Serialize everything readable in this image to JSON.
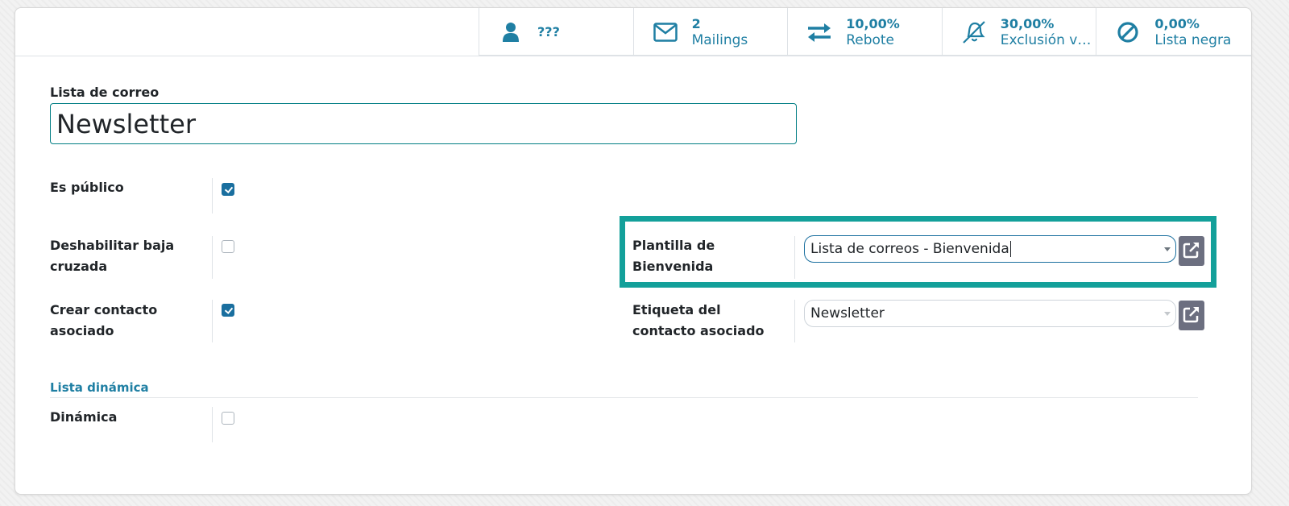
{
  "stats": [
    {
      "value": "???",
      "label": "",
      "icon": "user-icon"
    },
    {
      "value": "2",
      "label": "Mailings",
      "icon": "envelope-icon"
    },
    {
      "value": "10,00%",
      "label": "Rebote",
      "icon": "exchange-icon"
    },
    {
      "value": "30,00%",
      "label": "Exclusión vo...",
      "icon": "bell-slash-icon"
    },
    {
      "value": "0,00%",
      "label": "Lista negra",
      "icon": "ban-icon"
    }
  ],
  "form": {
    "name_label": "Lista de correo",
    "name_value": "Newsletter",
    "is_public_label": "Es público",
    "is_public": true,
    "disable_cross_unsub_label_1": "Deshabilitar baja",
    "disable_cross_unsub_label_2": "cruzada",
    "disable_cross_unsub": false,
    "create_contact_label_1": "Crear contacto",
    "create_contact_label_2": "asociado",
    "create_contact": true,
    "welcome_template_label_1": "Plantilla de",
    "welcome_template_label_2": "Bienvenida",
    "welcome_template_value": "Lista de correos - Bienvenida",
    "contact_tag_label_1": "Etiqueta del",
    "contact_tag_label_2": "contacto asociado",
    "contact_tag_value": "Newsletter",
    "dynamic_section_title": "Lista dinámica",
    "dynamic_label": "Dinámica",
    "dynamic": false
  },
  "colors": {
    "accent": "#1f7fa3",
    "highlight": "#13a09a",
    "checkbox": "#1a6f9f"
  }
}
